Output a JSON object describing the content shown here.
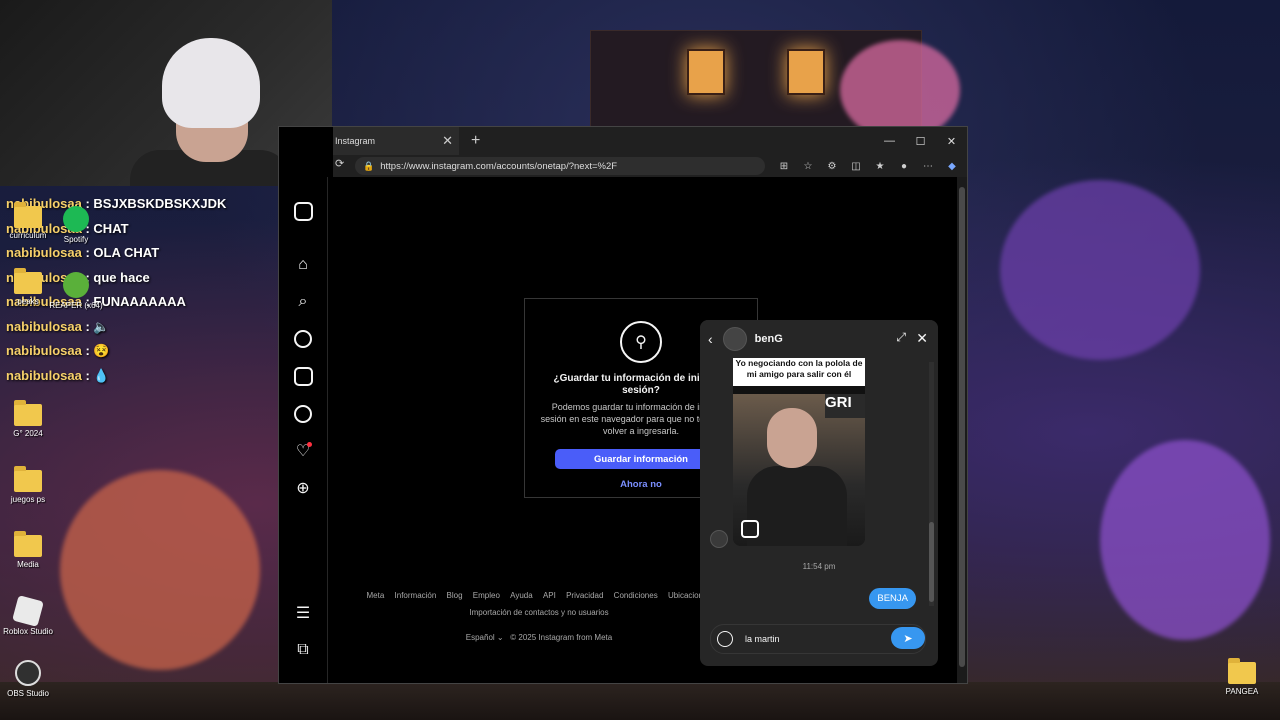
{
  "chat": [
    {
      "user": "nabibulosaa",
      "text": "BSJXBSKDBSKXJDK"
    },
    {
      "user": "nabibulosaa",
      "text": "CHAT"
    },
    {
      "user": "nabibulosaa",
      "text": "OLA CHAT"
    },
    {
      "user": "nabibulosaa",
      "text": "que hace"
    },
    {
      "user": "nabibulosaa",
      "text": "FUNAAAAAAA"
    },
    {
      "user": "nabibulosaa",
      "text": "🔈"
    },
    {
      "user": "nabibulosaa",
      "text": "😵"
    },
    {
      "user": "nabibulosaa",
      "text": "💧"
    }
  ],
  "desktop_icons": {
    "curriculum": "curriculum",
    "spotify": "Spotify",
    "peaks": "peaks",
    "reaper": "REAPER (x64)",
    "g2024": "G° 2024",
    "juegos": "juegos ps",
    "media": "Media",
    "roblox": "Roblox Studio",
    "obs": "OBS Studio",
    "pangea": "PANGEA"
  },
  "browser": {
    "tab_title": "Instagram",
    "url": "https://www.instagram.com/accounts/onetap/?next=%2F"
  },
  "save_dialog": {
    "title": "¿Guardar tu información de inicio de sesión?",
    "description": "Podemos guardar tu información de inicio de sesión en este navegador para que no tengas que volver a ingresarla.",
    "save_button": "Guardar información",
    "not_now": "Ahora no"
  },
  "footer": {
    "links": [
      "Meta",
      "Información",
      "Blog",
      "Empleo",
      "Ayuda",
      "API",
      "Privacidad",
      "Condiciones",
      "Ubicaciones"
    ],
    "row2": "Importación de contactos y no usuarios",
    "language": "Español",
    "copyright": "© 2025 Instagram from Meta"
  },
  "dm": {
    "name": "benG",
    "reel_caption": "Yo negociando con la polola de mi amigo para salir con él",
    "reel_overlay": "GRI",
    "time": "11:54 pm",
    "my_message": "BENJA",
    "input_value": "la martin"
  },
  "colors": {
    "accent": "#4a5df9",
    "dm_blue": "#3797f0",
    "chat_user": "#f6d06a"
  }
}
